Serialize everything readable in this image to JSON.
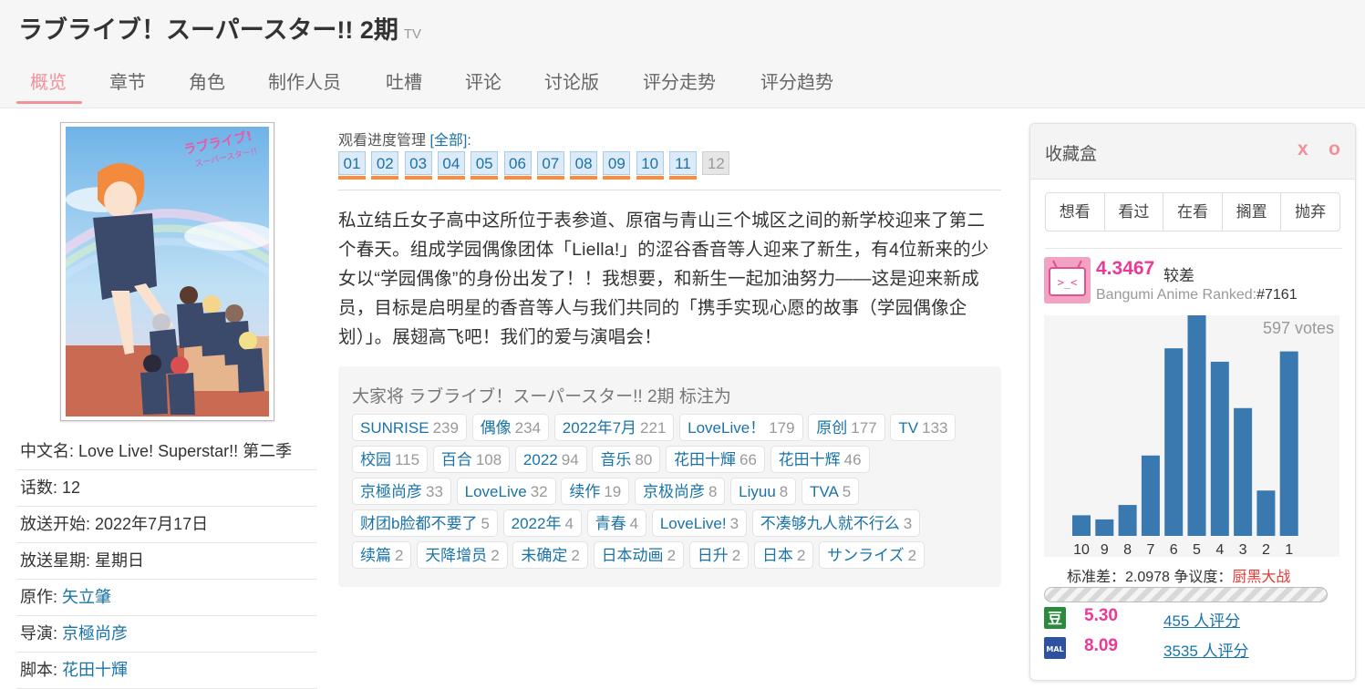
{
  "header": {
    "title": "ラブライブ！スーパースター!! 2期",
    "type": "TV"
  },
  "tabs": [
    "概览",
    "章节",
    "角色",
    "制作人员",
    "吐槽",
    "评论",
    "讨论版",
    "评分走势",
    "评分趋势"
  ],
  "infobox": [
    {
      "label": "中文名: ",
      "value": "Love Live! Superstar!! 第二季",
      "link": false
    },
    {
      "label": "话数: ",
      "value": "12",
      "link": false
    },
    {
      "label": "放送开始: ",
      "value": "2022年7月17日",
      "link": false
    },
    {
      "label": "放送星期: ",
      "value": "星期日",
      "link": false
    },
    {
      "label": "原作: ",
      "value": "矢立肇",
      "link": true
    },
    {
      "label": "导演: ",
      "value": "京極尚彦",
      "link": true
    },
    {
      "label": "脚本: ",
      "value": "花田十輝",
      "link": true
    }
  ],
  "progress": {
    "label": "观看进度管理 ",
    "all_link": "[全部]",
    "colon": ":",
    "episodes": [
      "01",
      "02",
      "03",
      "04",
      "05",
      "06",
      "07",
      "08",
      "09",
      "10",
      "11",
      "12"
    ],
    "aired_count": 11
  },
  "summary": "私立结丘女子高中这所位于表参道、原宿与青山三个城区之间的新学校迎来了第二个春天。组成学园偶像团体「Liella!」的涩谷香音等人迎来了新生，有4位新来的少女以“学园偶像”的身份出发了！！我想要，和新生一起加油努力——这是迎来新成员，目标是启明星的香音等人与我们共同的「携手实现心愿的故事（学园偶像企划）」。展翅高飞吧！我们的爱与演唱会！",
  "tags_title": "大家将 ラブライブ！スーパースター!! 2期 标注为",
  "tags": [
    {
      "name": "SUNRISE",
      "count": "239"
    },
    {
      "name": "偶像",
      "count": "234"
    },
    {
      "name": "2022年7月",
      "count": "221"
    },
    {
      "name": "LoveLive！",
      "count": "179"
    },
    {
      "name": "原创",
      "count": "177"
    },
    {
      "name": "TV",
      "count": "133"
    },
    {
      "name": "校园",
      "count": "115"
    },
    {
      "name": "百合",
      "count": "108"
    },
    {
      "name": "2022",
      "count": "94"
    },
    {
      "name": "音乐",
      "count": "80"
    },
    {
      "name": "花田十輝",
      "count": "66"
    },
    {
      "name": "花田十辉",
      "count": "46"
    },
    {
      "name": "京極尚彦",
      "count": "33"
    },
    {
      "name": "LoveLive",
      "count": "32"
    },
    {
      "name": "续作",
      "count": "19"
    },
    {
      "name": "京极尚彦",
      "count": "8"
    },
    {
      "name": "Liyuu",
      "count": "8"
    },
    {
      "name": "TVA",
      "count": "5"
    },
    {
      "name": "财团b脸都不要了",
      "count": "5"
    },
    {
      "name": "2022年",
      "count": "4"
    },
    {
      "name": "青春",
      "count": "4"
    },
    {
      "name": "LoveLive!",
      "count": "3"
    },
    {
      "name": "不凑够九人就不行么",
      "count": "3"
    },
    {
      "name": "续篇",
      "count": "2"
    },
    {
      "name": "天降增员",
      "count": "2"
    },
    {
      "name": "未确定",
      "count": "2"
    },
    {
      "name": "日本动画",
      "count": "2"
    },
    {
      "name": "日升",
      "count": "2"
    },
    {
      "name": "日本",
      "count": "2"
    },
    {
      "name": "サンライズ",
      "count": "2"
    }
  ],
  "panel": {
    "title": "收藏盒",
    "x": "x",
    "o": "o",
    "buttons": [
      "想看",
      "看过",
      "在看",
      "搁置",
      "抛弃"
    ],
    "score": "4.3467",
    "score_desc": "较差",
    "rank_label": "Bangumi Anime Ranked:",
    "rank_value": "#7161",
    "std_label": "标准差：2.0978 争议度：",
    "std_hot": "厨黑大战",
    "douban": {
      "score": "5.30",
      "votes": "455 人评分",
      "icon": "douban-icon"
    },
    "mal": {
      "score": "8.09",
      "votes": "3535 人评分",
      "icon": "mal-icon"
    },
    "colors": {
      "accent": "#f09199",
      "score": "#e93a97",
      "bar": "#3a78b0"
    }
  },
  "chart_data": {
    "type": "bar",
    "title": "597 votes",
    "categories": [
      "10",
      "9",
      "8",
      "7",
      "6",
      "5",
      "4",
      "3",
      "2",
      "1"
    ],
    "values": [
      20,
      16,
      30,
      78,
      182,
      214,
      169,
      124,
      44,
      179
    ],
    "ylim": [
      0,
      214
    ]
  }
}
